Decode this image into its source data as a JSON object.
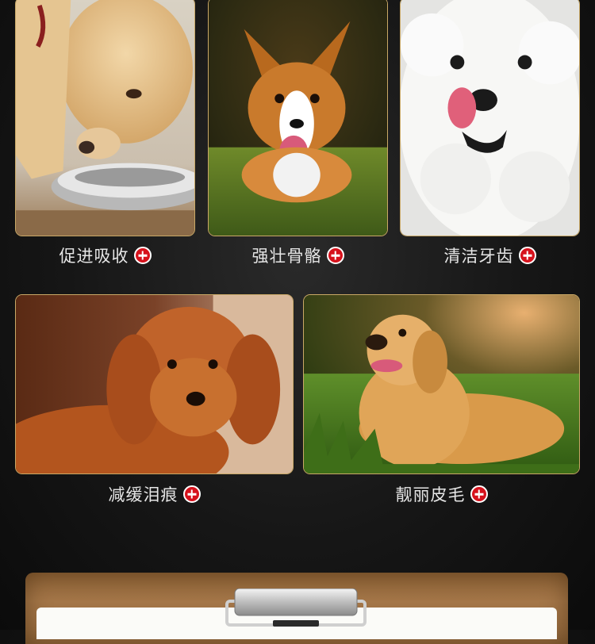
{
  "features": [
    {
      "label": "促进吸收",
      "image": "labrador-eating-from-bowl"
    },
    {
      "label": "强壮骨骼",
      "image": "corgi-running-on-grass"
    },
    {
      "label": "清洁牙齿",
      "image": "white-bichon-licking"
    },
    {
      "label": "减缓泪痕",
      "image": "red-poodle-lying"
    },
    {
      "label": "靓丽皮毛",
      "image": "golden-retriever-in-grass"
    }
  ],
  "colors": {
    "frame_gold": "#c9a866",
    "plus_red": "#d6121c",
    "background": "#161616",
    "clipboard_wood": "#a47648"
  },
  "icons": {
    "feature_marker": "plus-circle-icon"
  }
}
